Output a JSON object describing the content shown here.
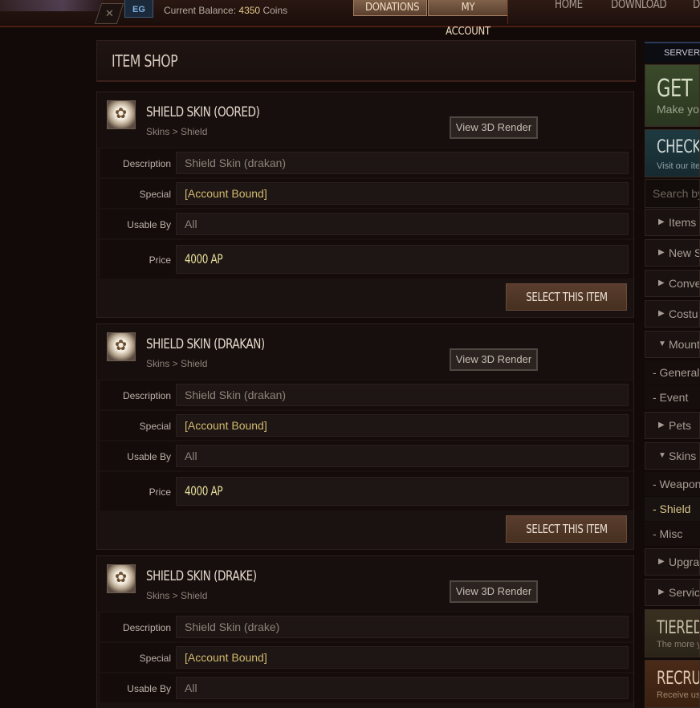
{
  "topbar": {
    "close_icon": "close-icon",
    "logo_text": "EG",
    "balance_label": "Current Balance:",
    "balance_amount": "4350",
    "balance_unit": "Coins",
    "buttons": {
      "donations": "DONATIONS",
      "my_account": "MY ACCOUNT"
    },
    "links": {
      "home": "HOME",
      "download": "DOWNLOAD",
      "more": "DI"
    }
  },
  "shop": {
    "title": "ITEM SHOP",
    "labels": {
      "description": "Description",
      "special": "Special",
      "usable_by": "Usable By",
      "price": "Price",
      "view_3d": "View 3D Render",
      "select": "SELECT THIS ITEM"
    },
    "items": [
      {
        "name": "SHIELD SKIN (OORED)",
        "category": "Skins > Shield",
        "description": "Shield Skin (drakan)",
        "special": "[Account Bound]",
        "usable_by": "All",
        "price": "4000 AP"
      },
      {
        "name": "SHIELD SKIN (DRAKAN)",
        "category": "Skins > Shield",
        "description": "Shield Skin (drakan)",
        "special": "[Account Bound]",
        "usable_by": "All",
        "price": "4000 AP"
      },
      {
        "name": "SHIELD SKIN (DRAKE)",
        "category": "Skins > Shield",
        "description": "Shield Skin (drake)",
        "special": "[Account Bound]",
        "usable_by": "All",
        "price": ""
      }
    ]
  },
  "sidebar": {
    "server_tab": "SERVER",
    "promo_get": {
      "title": "GET M",
      "sub": "Make yo"
    },
    "promo_check": {
      "title": "CHECK C",
      "sub": "Visit our ite"
    },
    "search_placeholder": "Search by",
    "categories": {
      "items": "Items",
      "new": "New S",
      "conv": "Conve",
      "costume": "Costu",
      "mounts": "Mount",
      "pets": "Pets",
      "skins": "Skins",
      "upgrades": "Upgra",
      "services": "Servic"
    },
    "mount_subs": {
      "general": "- General",
      "event": "- Event"
    },
    "skin_subs": {
      "weapon": "- Weapon",
      "shield": "- Shield",
      "misc": "- Misc"
    },
    "promo_tiered": {
      "title": "TIERED R",
      "sub": "The more y"
    },
    "promo_recruit": {
      "title": "RECRUIT",
      "sub": "Receive us"
    }
  },
  "colors": {
    "background": "#120a08",
    "accent_gold": "#d1b96e",
    "price_yellow": "#e8df9a",
    "promo_green": "#3a4a2a",
    "promo_teal": "#1e3a40",
    "promo_brown": "#3a3020",
    "promo_rust": "#4a2a18"
  }
}
